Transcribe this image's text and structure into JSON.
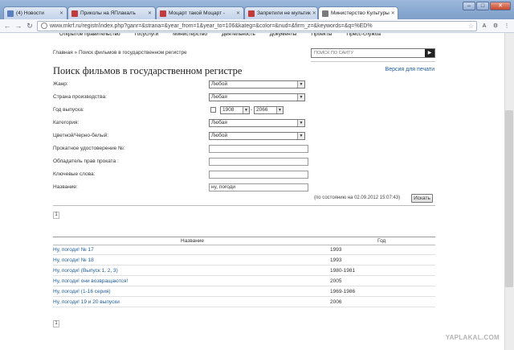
{
  "browser": {
    "tabs": [
      {
        "label": "(4) Новости",
        "fav_color": "#5a7fc0"
      },
      {
        "label": "Приколы на ЯПлакалъ",
        "fav_color": "#c23a3a"
      },
      {
        "label": "Моцарт такой Моцарт - ",
        "fav_color": "#c23a3a"
      },
      {
        "label": "Запретили не мультик ",
        "fav_color": "#c23a3a"
      },
      {
        "label": "Министерство Культуры ",
        "fav_color": "#7a7a7a"
      }
    ],
    "url": "www.mkrf.ru/registr/index.php?ganr=&strana=&year_from=1&year_to=106&kateg=&color=&nud=&firm_z=&keywords=&q=%ED%",
    "back_icon": "←",
    "forward_icon": "→",
    "reload_icon": "↻",
    "star_icon": "☆",
    "ext1": "A",
    "ext2": "⚙",
    "ext3": "⋮",
    "min": "–",
    "max": "□",
    "close": "✕",
    "tab_close": "✕"
  },
  "site": {
    "topnav": [
      "Открытое правительство",
      "Госуслуги",
      "Министерство",
      "Деятельность",
      "Документы",
      "Проекты",
      "Пресс-служба"
    ],
    "breadcrumb": "Главная » Поиск фильмов в государственном регистре",
    "search_placeholder": "ПОИСК ПО САЙТУ",
    "search_go": "▶",
    "title": "Поиск фильмов в государственном регистре",
    "print_link": "Версия для печати"
  },
  "form": {
    "genre": {
      "label": "Жанр:",
      "value": "Любой"
    },
    "country": {
      "label": "Страна производства:",
      "value": "Любая"
    },
    "year": {
      "label": "Год выпуска:",
      "from": "1908",
      "to": "2066",
      "dash": "-"
    },
    "category": {
      "label": "Категория:",
      "value": "Любая"
    },
    "color": {
      "label": "Цветной/Черно-белый:",
      "value": "Любой"
    },
    "certificate": {
      "label": "Прокатное удостоверение №:",
      "value": ""
    },
    "rights_holder": {
      "label": "Обладатель прав проката :",
      "value": ""
    },
    "keywords": {
      "label": "Ключевые слова:",
      "value": ""
    },
    "name": {
      "label": "Название:",
      "value": "ну, погоди"
    },
    "as_of": "(по состоянию на 02.09.2012 15:07:43)",
    "find_button": "Искать",
    "arrow": "▼"
  },
  "pager": {
    "page": "1"
  },
  "results": {
    "col_name": "Название",
    "col_year": "Год",
    "rows": [
      {
        "name": "Ну, погоди! № 17",
        "year": "1993"
      },
      {
        "name": "Ну, погоди! № 18",
        "year": "1993"
      },
      {
        "name": "Ну, погоди! (Выпуск 1, 2, 3)",
        "year": "1980-1981"
      },
      {
        "name": "Ну, погоди! они возвращаются!",
        "year": "2005"
      },
      {
        "name": "Ну, погоди! (1-16 серия)",
        "year": "1969-1986"
      },
      {
        "name": "Ну, погоди! 19 и 20 выпуски",
        "year": "2006"
      }
    ]
  },
  "watermark": "YAPLAKAL.COM"
}
